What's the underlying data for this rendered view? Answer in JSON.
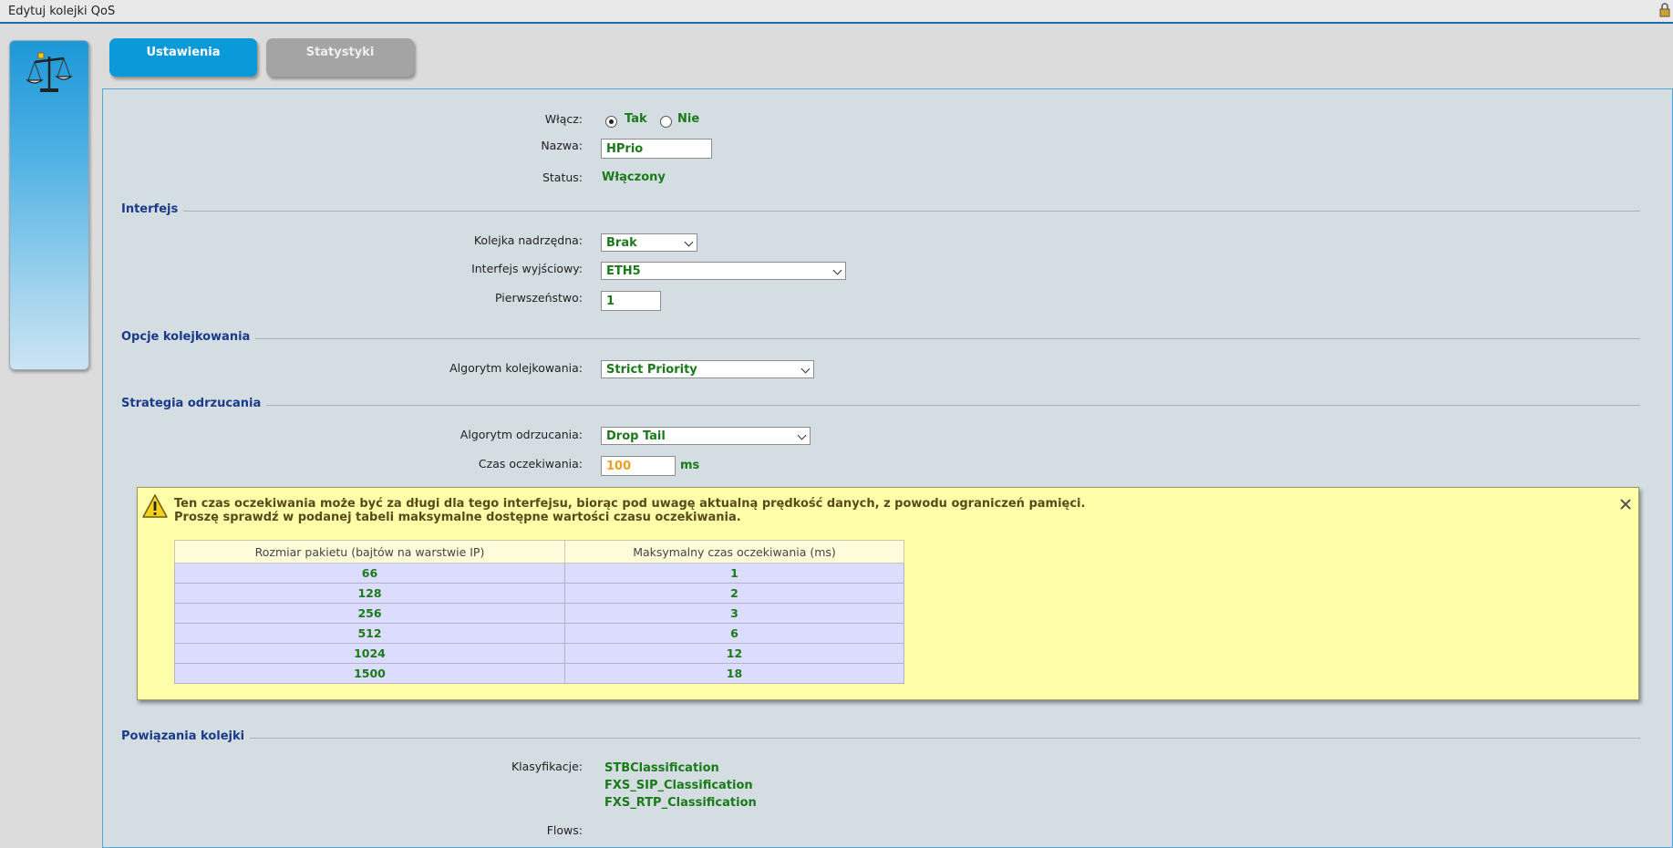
{
  "window": {
    "title": "Edytuj kolejki QoS"
  },
  "tabs": [
    {
      "label": "Ustawienia",
      "active": true
    },
    {
      "label": "Statystyki",
      "active": false
    }
  ],
  "general": {
    "enable_label": "Włącz:",
    "enable_yes": "Tak",
    "enable_no": "Nie",
    "enable_selected": "Tak",
    "name_label": "Nazwa:",
    "name_value": "HPrio",
    "status_label": "Status:",
    "status_value": "Włączony"
  },
  "interface_section": {
    "title": "Interfejs",
    "parent_label": "Kolejka nadrzędna:",
    "parent_value": "Brak",
    "output_label": "Interfejs wyjściowy:",
    "output_value": "ETH5",
    "priority_label": "Pierwszeństwo:",
    "priority_value": "1"
  },
  "queuing_section": {
    "title": "Opcje kolejkowania",
    "algorithm_label": "Algorytm kolejkowania:",
    "algorithm_value": "Strict Priority"
  },
  "drop_section": {
    "title": "Strategia odrzucania",
    "algorithm_label": "Algorytm odrzucania:",
    "algorithm_value": "Drop Tail",
    "wait_label": "Czas oczekiwania:",
    "wait_value": "100",
    "wait_unit": "ms"
  },
  "warning": {
    "line1": "Ten czas oczekiwania może być za długi dla tego interfejsu, biorąc pod uwagę aktualną prędkość danych, z powodu ograniczeń pamięci.",
    "line2": "Proszę sprawdź w podanej tabeli maksymalne dostępne wartości czasu oczekiwania.",
    "table": {
      "headers": [
        "Rozmiar pakietu (bajtów na warstwie IP)",
        "Maksymalny czas oczekiwania (ms)"
      ],
      "rows": [
        [
          "66",
          "1"
        ],
        [
          "128",
          "2"
        ],
        [
          "256",
          "3"
        ],
        [
          "512",
          "6"
        ],
        [
          "1024",
          "12"
        ],
        [
          "1500",
          "18"
        ]
      ]
    }
  },
  "bindings_section": {
    "title": "Powiązania kolejki",
    "classifications_label": "Klasyfikacje:",
    "classifications": [
      "STBClassification",
      "FXS_SIP_Classification",
      "FXS_RTP_Classification"
    ],
    "flows_label": "Flows:"
  },
  "colors": {
    "accent": "#0a9ad9",
    "value_green": "#1a7a1a",
    "section_blue": "#1a3a8a",
    "warning_bg": "#ffffaa",
    "wait_orange": "#f0a020"
  }
}
